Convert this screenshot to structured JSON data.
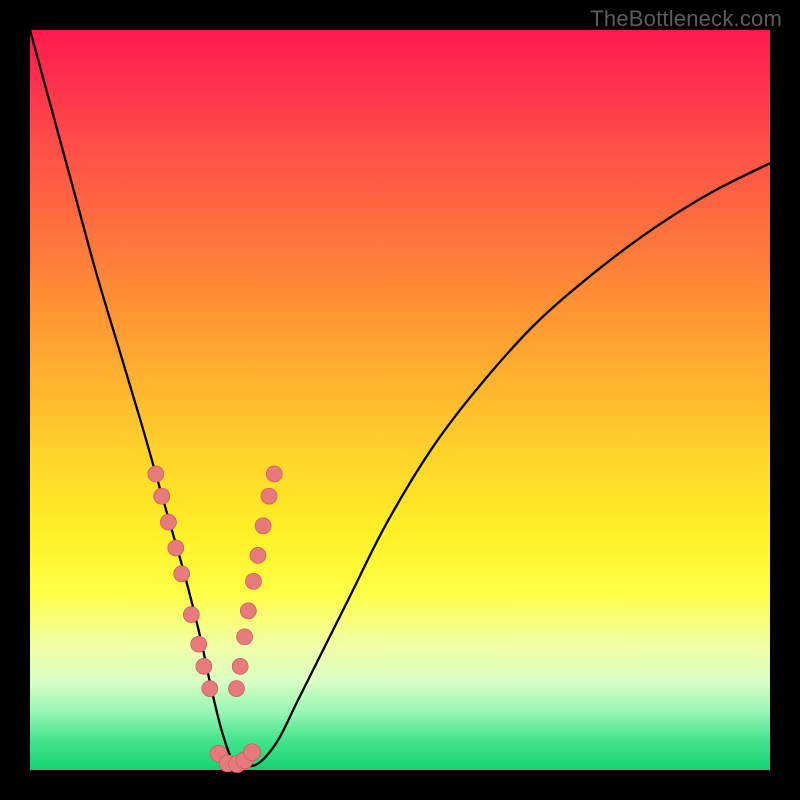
{
  "watermark": {
    "text": "TheBottleneck.com"
  },
  "chart_data": {
    "type": "line",
    "title": "",
    "xlabel": "",
    "ylabel": "",
    "xlim": [
      0,
      100
    ],
    "ylim": [
      0,
      100
    ],
    "series": [
      {
        "name": "bottleneck-curve",
        "x": [
          0,
          3,
          6,
          9,
          12,
          15,
          17,
          19,
          21,
          23,
          24.5,
          26,
          27.5,
          29,
          31,
          33.5,
          36,
          39,
          43,
          48,
          54,
          60,
          68,
          76,
          84,
          92,
          100
        ],
        "y": [
          100,
          89,
          78,
          67,
          57,
          47,
          40,
          33,
          26,
          18,
          11,
          5,
          1,
          0.5,
          1,
          4,
          9,
          15,
          23,
          33,
          43,
          51,
          60,
          67,
          73,
          78,
          82
        ]
      }
    ],
    "annotations": {
      "dots_left": [
        {
          "x": 17,
          "y": 40
        },
        {
          "x": 17.8,
          "y": 37
        },
        {
          "x": 18.7,
          "y": 33.5
        },
        {
          "x": 19.7,
          "y": 30
        },
        {
          "x": 20.5,
          "y": 26.5
        },
        {
          "x": 21.8,
          "y": 21
        },
        {
          "x": 22.8,
          "y": 17
        },
        {
          "x": 23.5,
          "y": 14
        },
        {
          "x": 24.3,
          "y": 11
        }
      ],
      "dots_right": [
        {
          "x": 33,
          "y": 40
        },
        {
          "x": 32.3,
          "y": 37
        },
        {
          "x": 31.5,
          "y": 33
        },
        {
          "x": 30.8,
          "y": 29
        },
        {
          "x": 30.2,
          "y": 25.5
        },
        {
          "x": 29.5,
          "y": 21.5
        },
        {
          "x": 29,
          "y": 18
        },
        {
          "x": 28.4,
          "y": 14
        },
        {
          "x": 27.9,
          "y": 11
        }
      ],
      "dots_bottom": [
        {
          "x": 25.5,
          "y": 2.2
        },
        {
          "x": 26.7,
          "y": 0.9
        },
        {
          "x": 28,
          "y": 0.8
        },
        {
          "x": 29,
          "y": 1.3
        },
        {
          "x": 30,
          "y": 2.4
        }
      ],
      "colors": {
        "curve": "#000000",
        "dot_fill": "#e77a7a",
        "dot_stroke": "#c85a5a"
      }
    }
  }
}
